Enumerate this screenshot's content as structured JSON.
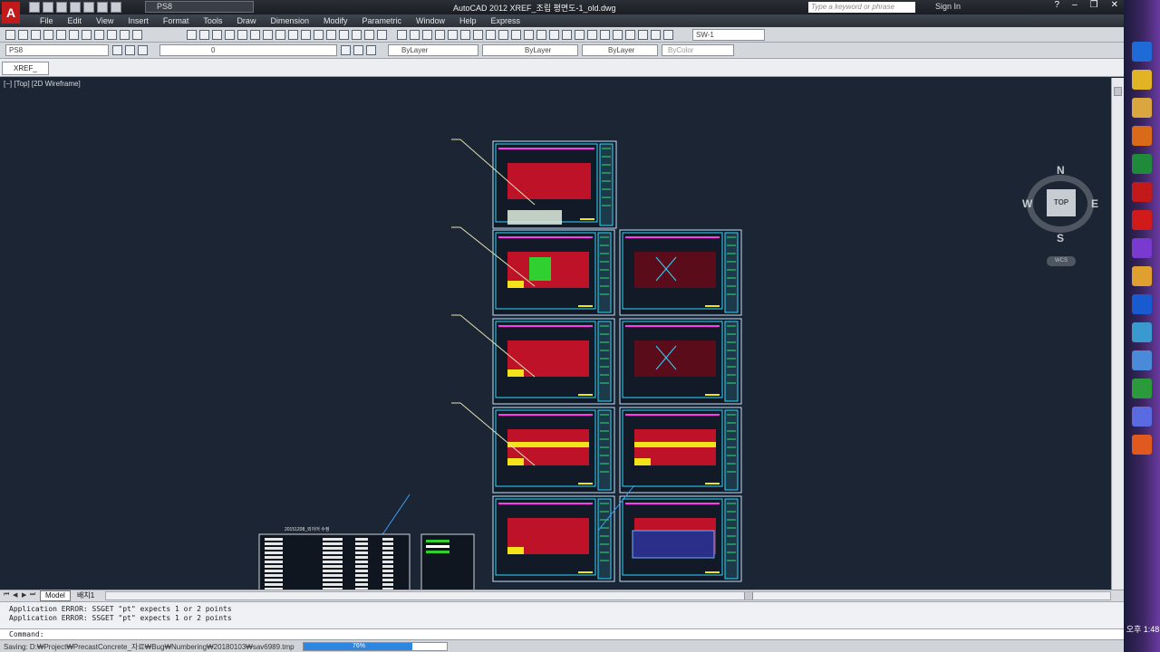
{
  "window": {
    "title": "AutoCAD 2012    XREF_조립 평면도-1_old.dwg",
    "workspace": "PS8",
    "search_placeholder": "Type a keyword or phrase",
    "sign_in": "Sign In"
  },
  "menu": [
    "File",
    "Edit",
    "View",
    "Insert",
    "Format",
    "Tools",
    "Draw",
    "Dimension",
    "Modify",
    "Parametric",
    "Window",
    "Help",
    "Express"
  ],
  "toolbar": {
    "named_view": "SW-1",
    "layer_select": "PS8",
    "layer_current": "0",
    "color": "ByLayer",
    "linetype": "ByLayer",
    "lineweight": "ByLayer",
    "plotstyle": "ByColor"
  },
  "file_tab": "XREF_조...",
  "viewport_label": "[−] [Top] [2D Wireframe]",
  "viewcube": {
    "face": "TOP",
    "north": "N",
    "south": "S",
    "east": "E",
    "west": "W",
    "ucs": "WCS"
  },
  "layout_tabs": [
    "Model",
    "배치1"
  ],
  "command_history": [
    "Application ERROR: SSGET \"pt\" expects 1 or 2 points",
    "Application ERROR: SSGET \"pt\" expects 1 or 2 points"
  ],
  "command_prompt": "Command:",
  "status": {
    "text": "Saving: D:₩Project₩PrecastConcrete_자료₩Bug₩Numbering₩20180103₩sav6989.tmp",
    "progress_label": "76%",
    "progress": 0.76
  },
  "drawing_title": "20151208_외이어 수정",
  "taskbar": {
    "clock": "오후 1:48",
    "apps": [
      "internet-explorer-icon",
      "chrome-icon",
      "file-explorer-icon",
      "media-player-icon",
      "excel-icon",
      "autocad-icon",
      "acrobat-icon",
      "visual-studio-icon",
      "bug-tool-icon",
      "dp-icon",
      "paint-icon",
      "document-icon",
      "chart-icon",
      "network-icon",
      "office-icon"
    ]
  },
  "colors": {
    "canvas": "#1b2533",
    "accent": "#2d86e0"
  }
}
